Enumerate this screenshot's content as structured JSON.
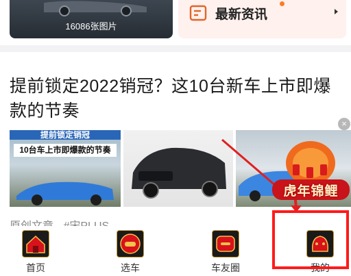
{
  "gallery": {
    "count_label": "16086张图片"
  },
  "news": {
    "title": "最新资讯"
  },
  "article": {
    "title": "提前锁定2022销冠？这10台新车上市即爆款的节奏",
    "thumb_header": "提前锁定销冠",
    "thumb_caption": "10台车上市即爆款的节奏",
    "meta": [
      "原创文章",
      "#宋PLUS"
    ]
  },
  "promo": {
    "text": "虎年锦鲤"
  },
  "close": {
    "glyph": "×"
  },
  "bottom_nav": {
    "items": [
      {
        "label": "首页",
        "icon": "home-icon"
      },
      {
        "label": "选车",
        "icon": "select-car-icon"
      },
      {
        "label": "车友圈",
        "icon": "car-circle-icon"
      },
      {
        "label": "我的",
        "icon": "profile-icon"
      }
    ]
  },
  "colors": {
    "accent_red": "#e02020",
    "highlight": "#ff1a1a",
    "nav_icon_bg": "#1a1a1a",
    "news_bg": "#fff1ee",
    "news_dot": "#ff7a22"
  }
}
